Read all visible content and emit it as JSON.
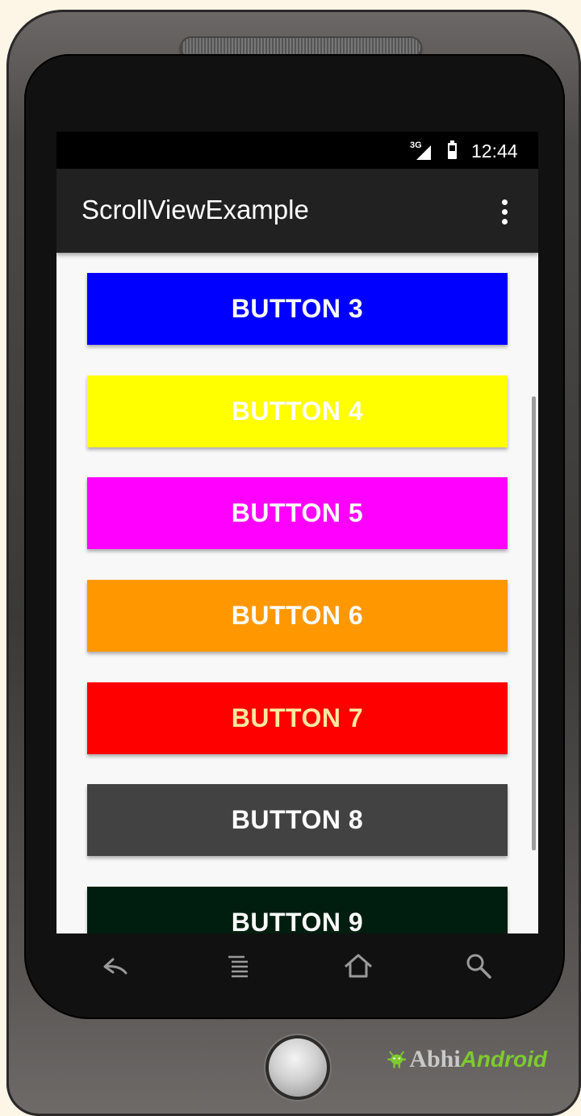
{
  "status_bar": {
    "network": "3G",
    "time": "12:44"
  },
  "app_bar": {
    "title": "ScrollViewExample",
    "overflow_icon": "more-vert-icon"
  },
  "buttons": [
    {
      "label": "BUTTON 3",
      "color": "#0000ff",
      "text_color": "#ffffff"
    },
    {
      "label": "BUTTON 4",
      "color": "#ffff00",
      "text_color": "#ffffff"
    },
    {
      "label": "BUTTON 5",
      "color": "#ff00ff",
      "text_color": "#ffffff"
    },
    {
      "label": "BUTTON 6",
      "color": "#ff9800",
      "text_color": "#ffffff"
    },
    {
      "label": "BUTTON 7",
      "color": "#ff0000",
      "text_color": "#ffe9a0"
    },
    {
      "label": "BUTTON 8",
      "color": "#424242",
      "text_color": "#ffffff"
    },
    {
      "label": "BUTTON 9",
      "color": "#001e10",
      "text_color": "#ffffff"
    }
  ],
  "nav_bar": {
    "icons": [
      "back-icon",
      "menu-icon",
      "home-icon",
      "search-icon"
    ]
  },
  "watermark": {
    "text_a": "Abhi",
    "text_b": "Android"
  }
}
